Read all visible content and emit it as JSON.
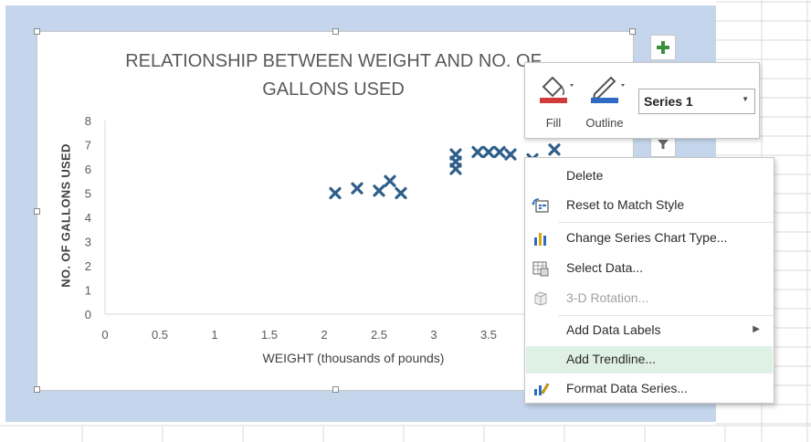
{
  "chart_data": {
    "type": "scatter",
    "title_lines": [
      "RELATIONSHIP BETWEEN WEIGHT AND NO. OF",
      "GALLONS USED"
    ],
    "xlabel": "WEIGHT (thousands of pounds)",
    "ylabel": "NO. OF GALLONS USED",
    "xlim": [
      0,
      4.5
    ],
    "ylim": [
      0,
      8
    ],
    "x_ticks": [
      "0",
      "0.5",
      "1",
      "1.5",
      "2",
      "2.5",
      "3",
      "3.5"
    ],
    "y_ticks": [
      "0",
      "1",
      "2",
      "3",
      "4",
      "5",
      "6",
      "7",
      "8"
    ],
    "grid": false,
    "series": [
      {
        "name": "Series 1",
        "marker": "x",
        "color": "#2e5f8a",
        "points": [
          {
            "x": 2.1,
            "y": 5.0
          },
          {
            "x": 2.3,
            "y": 5.2
          },
          {
            "x": 2.5,
            "y": 5.1
          },
          {
            "x": 2.6,
            "y": 5.5
          },
          {
            "x": 2.7,
            "y": 5.0
          },
          {
            "x": 3.2,
            "y": 6.0
          },
          {
            "x": 3.2,
            "y": 6.3
          },
          {
            "x": 3.2,
            "y": 6.6
          },
          {
            "x": 3.4,
            "y": 6.7
          },
          {
            "x": 3.5,
            "y": 6.7
          },
          {
            "x": 3.6,
            "y": 6.7
          },
          {
            "x": 3.7,
            "y": 6.6
          },
          {
            "x": 3.9,
            "y": 6.4
          },
          {
            "x": 4.1,
            "y": 6.8
          }
        ]
      }
    ]
  },
  "side_buttons": [
    {
      "icon": "plus-icon",
      "color": "#3b8f3b"
    },
    {
      "icon": "filter-icon",
      "color": "#555555"
    }
  ],
  "mini_toolbar": {
    "fill_label": "Fill",
    "outline_label": "Outline",
    "series_value": "Series 1",
    "fill_color": "#d23b3b",
    "outline_color": "#2d6bc4"
  },
  "context_menu": {
    "items": [
      {
        "label": "Delete",
        "icon": ""
      },
      {
        "label": "Reset to Match Style",
        "icon": "reset-style-icon"
      },
      {
        "label": "Change Series Chart Type...",
        "icon": "chart-type-icon"
      },
      {
        "label": "Select Data...",
        "icon": "select-data-icon"
      },
      {
        "label": "3-D Rotation...",
        "icon": "rotation-3d-icon"
      },
      {
        "label": "Add Data Labels",
        "icon": ""
      },
      {
        "label": "Add Trendline...",
        "icon": ""
      },
      {
        "label": "Format Data Series...",
        "icon": "format-series-icon"
      }
    ],
    "submenu_arrow": "▶"
  }
}
